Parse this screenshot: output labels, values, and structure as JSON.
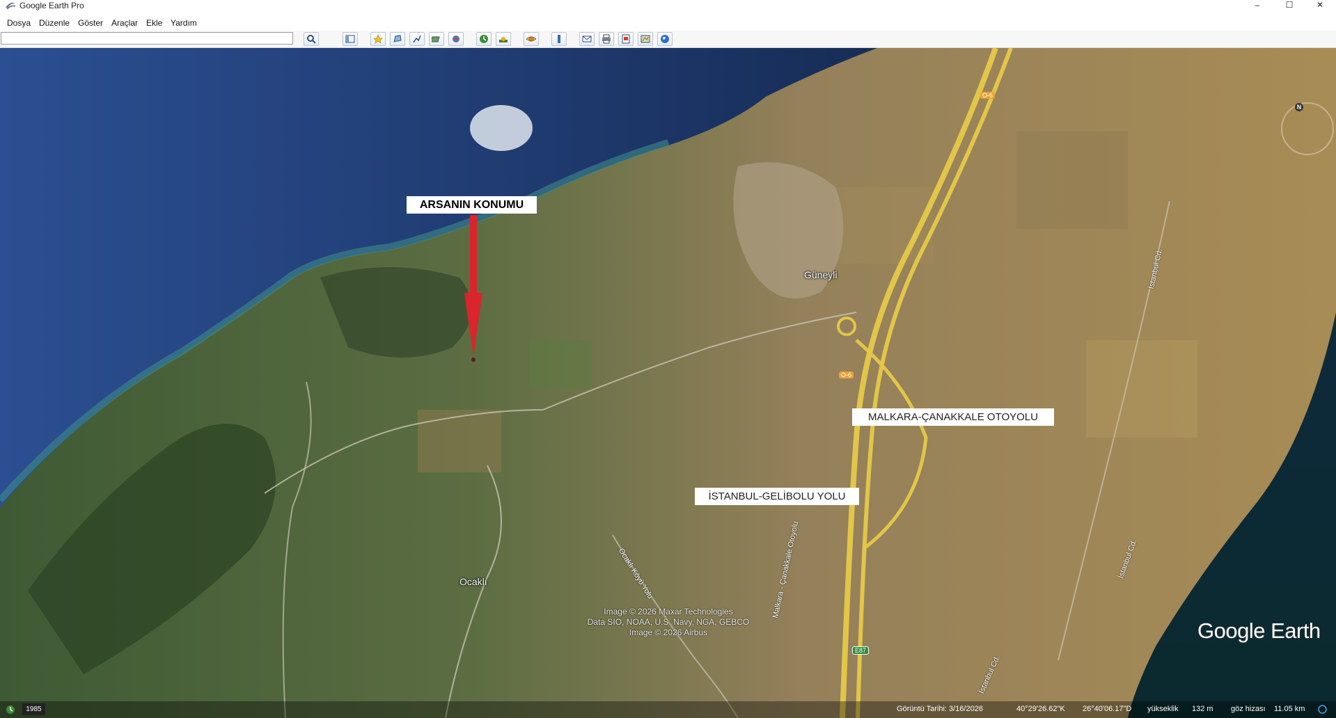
{
  "window": {
    "title": "Google Earth Pro",
    "controls": {
      "minimize": "–",
      "maximize": "☐",
      "close": "✕"
    }
  },
  "menu": [
    {
      "label": "Dosya"
    },
    {
      "label": "Düzenle"
    },
    {
      "label": "Göster"
    },
    {
      "label": "Araçlar"
    },
    {
      "label": "Ekle"
    },
    {
      "label": "Yardım"
    }
  ],
  "search": {
    "value": "",
    "placeholder": ""
  },
  "toolbar": {
    "icons": [
      "search-icon",
      "sidebar-icon",
      "placemark-icon",
      "polygon-icon",
      "path-icon",
      "image-overlay-icon",
      "record-tour-icon",
      "historical-imagery-icon",
      "sunlight-icon",
      "planets-icon",
      "ruler-icon",
      "email-icon",
      "print-icon",
      "save-image-icon",
      "view-in-maps-icon",
      "earth-icon"
    ]
  },
  "map": {
    "callouts": {
      "land": "ARSANIN KONUMU",
      "highway": "MALKARA-ÇANAKKALE OTOYOLU",
      "road": "İSTANBUL-GELİBOLU YOLU"
    },
    "places": {
      "guneyli": "Güneyli",
      "ocakli": "Ocaklı"
    },
    "road_labels": {
      "o6_top": "O-6",
      "o6_mid": "O-6",
      "e87": "E87",
      "malkara": "Malkara - Çanakkale Otoyolu",
      "istanbul_cd": "İstanbul Cd.",
      "istanbul_cd2": "İstanbul Cd.",
      "istanbul_cd3": "İstanbul Cd.",
      "ocakli_koyu": "Ocaklı Köyü Yolu"
    },
    "attribution": [
      "Image © 2026 Maxar Technologies",
      "Data SIO, NOAA, U.S. Navy, NGA, GEBCO",
      "Image © 2026 Airbus"
    ],
    "brand": "Google Earth",
    "colors": {
      "sea": "#1c3566",
      "land": "#9b8a63",
      "callout_arrow": "#d8262c"
    }
  },
  "status": {
    "year": "1985",
    "imagery_date": "Görüntü Tarihi: 3/16/2026",
    "lat": "40°29'26.62\"K",
    "lon": "26°40'06.17\"D",
    "elevation_label": "yükseklik",
    "elevation": "132 m",
    "eye_label": "göz hizası",
    "eye_alt": "11.05 km"
  }
}
